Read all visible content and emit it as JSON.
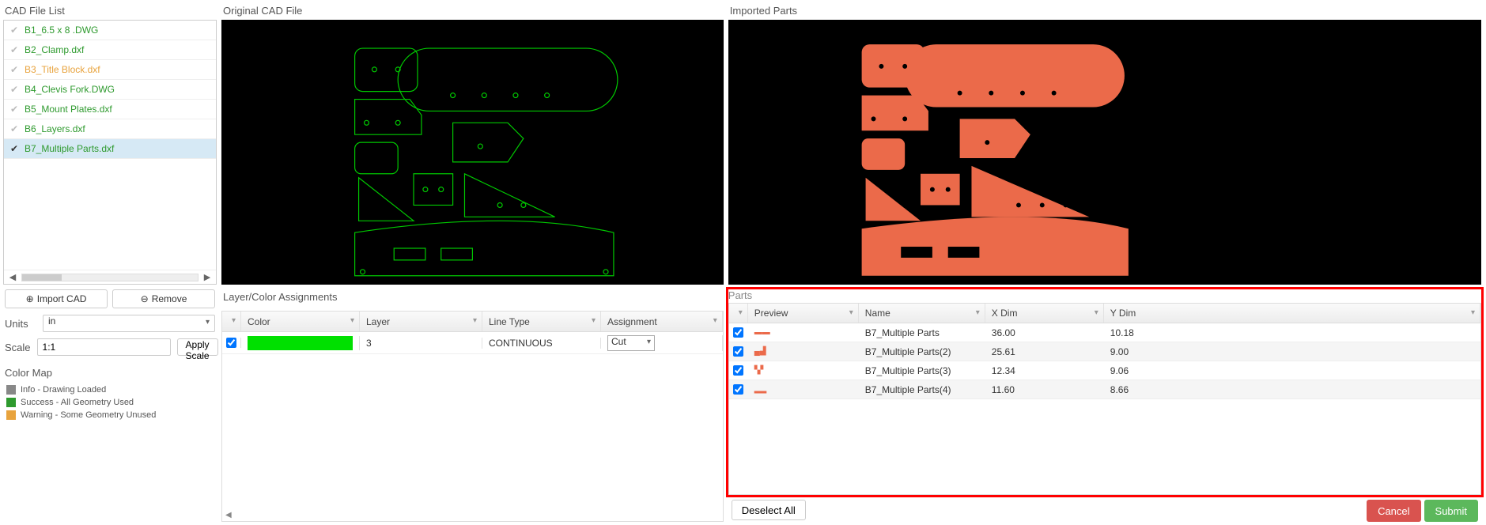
{
  "left": {
    "cad_list_title": "CAD File List",
    "files": [
      {
        "name": "B1_6.5 x 8 .DWG",
        "status": "success",
        "selected": false
      },
      {
        "name": "B2_Clamp.dxf",
        "status": "success",
        "selected": false
      },
      {
        "name": "B3_Title Block.dxf",
        "status": "warning",
        "selected": false
      },
      {
        "name": "B4_Clevis Fork.DWG",
        "status": "success",
        "selected": false
      },
      {
        "name": "B5_Mount Plates.dxf",
        "status": "success",
        "selected": false
      },
      {
        "name": "B6_Layers.dxf",
        "status": "success",
        "selected": false
      },
      {
        "name": "B7_Multiple Parts.dxf",
        "status": "success",
        "selected": true
      }
    ],
    "import_btn": "Import CAD",
    "remove_btn": "Remove",
    "units_label": "Units",
    "units_value": "in",
    "scale_label": "Scale",
    "scale_value": "1:1",
    "apply_scale_btn": "Apply Scale",
    "color_map_title": "Color Map",
    "legend": [
      {
        "color": "#888888",
        "text": "Info - Drawing Loaded"
      },
      {
        "color": "#2e9a2e",
        "text": "Success - All Geometry Used"
      },
      {
        "color": "#e8a33d",
        "text": "Warning - Some Geometry Unused"
      }
    ]
  },
  "mid": {
    "original_title": "Original CAD File",
    "layer_table_title": "Layer/Color Assignments",
    "columns": {
      "color": "Color",
      "layer": "Layer",
      "linetype": "Line Type",
      "assignment": "Assignment"
    },
    "rows": [
      {
        "checked": true,
        "swatch": "#00e000",
        "layer": "3",
        "linetype": "CONTINUOUS",
        "assignment": "Cut"
      }
    ]
  },
  "right": {
    "imported_title": "Imported Parts",
    "parts_label": "Parts",
    "columns": {
      "preview": "Preview",
      "name": "Name",
      "xdim": "X Dim",
      "ydim": "Y Dim"
    },
    "rows": [
      {
        "checked": true,
        "name": "B7_Multiple Parts",
        "xdim": "36.00",
        "ydim": "10.18"
      },
      {
        "checked": true,
        "name": "B7_Multiple Parts(2)",
        "xdim": "25.61",
        "ydim": "9.00"
      },
      {
        "checked": true,
        "name": "B7_Multiple Parts(3)",
        "xdim": "12.34",
        "ydim": "9.06"
      },
      {
        "checked": true,
        "name": "B7_Multiple Parts(4)",
        "xdim": "11.60",
        "ydim": "8.66"
      }
    ],
    "deselect_btn": "Deselect All",
    "cancel_btn": "Cancel",
    "submit_btn": "Submit"
  }
}
